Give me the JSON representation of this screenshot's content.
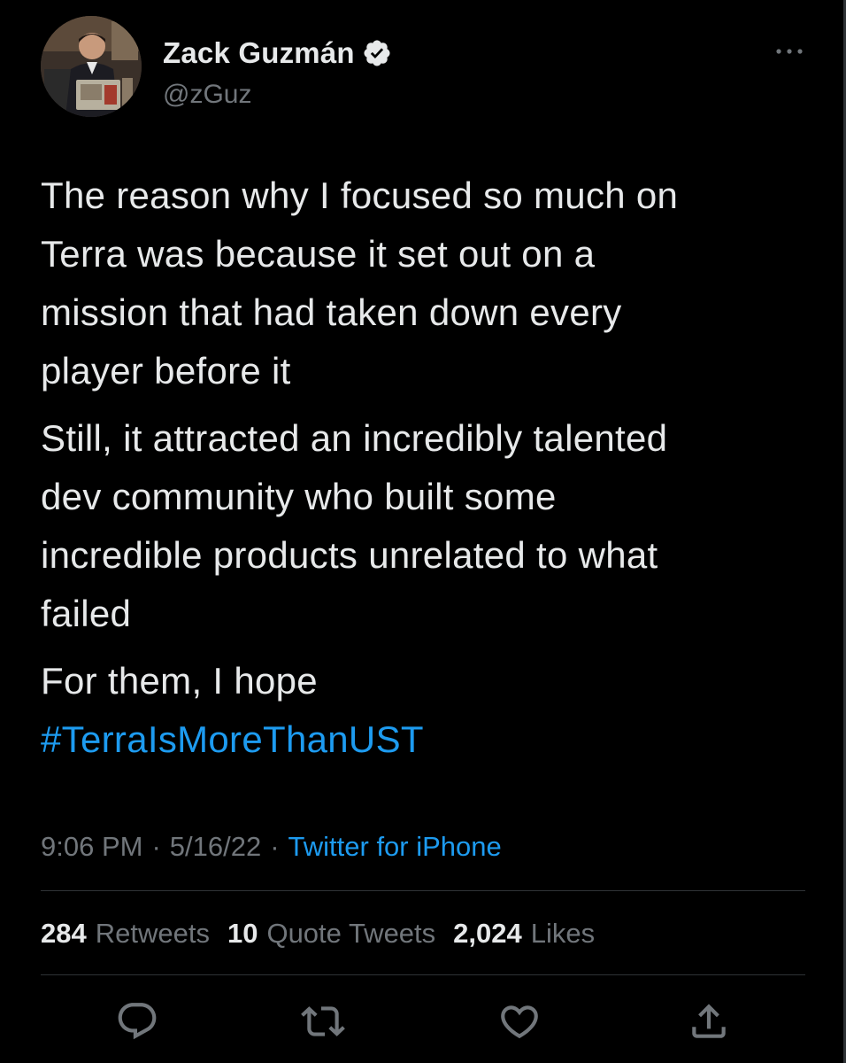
{
  "author": {
    "display_name": "Zack Guzmán",
    "handle": "@zGuz",
    "verified": true,
    "avatar_icon": "profile-photo"
  },
  "tweet": {
    "paragraphs": [
      [
        "The reason why I focused so much on",
        "Terra was because it set out on a",
        "mission that had taken down every",
        "player before it"
      ],
      [
        "Still, it attracted an incredibly talented",
        "dev community who built some",
        "incredible products unrelated to what",
        "failed"
      ],
      [
        "For them, I hope"
      ]
    ],
    "hashtag": "#TerraIsMoreThanUST"
  },
  "meta": {
    "time": "9:06 PM",
    "separator": "·",
    "date": "5/16/22",
    "source": "Twitter for iPhone"
  },
  "stats": {
    "retweets_count": "284",
    "retweets_label": "Retweets",
    "quotes_count": "10",
    "quotes_label": "Quote Tweets",
    "likes_count": "2,024",
    "likes_label": "Likes"
  },
  "actions": {
    "icons": [
      "reply-icon",
      "retweet-icon",
      "like-icon",
      "share-icon"
    ]
  },
  "colors": {
    "background": "#000000",
    "text_primary": "#e7e9ea",
    "text_secondary": "#71767b",
    "link": "#1d9bf0",
    "divider": "#2f3336"
  }
}
